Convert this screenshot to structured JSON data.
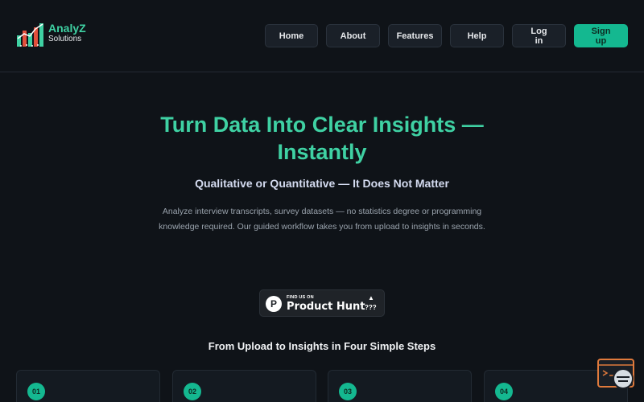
{
  "brand": {
    "name": "AnalyZ",
    "tagline": "Solutions",
    "accent": "#3fd1a3"
  },
  "nav": {
    "items": [
      {
        "label": "Home"
      },
      {
        "label": "About"
      },
      {
        "label": "Features"
      },
      {
        "label": "Help"
      },
      {
        "label": "Log in"
      }
    ],
    "cta": "Sign up"
  },
  "hero": {
    "title_line1": "Turn Data Into Clear Insights —",
    "title_line2": "Instantly",
    "subtitle": "Qualitative or Quantitative — It Does Not Matter",
    "description": "Analyze interview transcripts, survey datasets — no statistics degree or programming knowledge required. Our guided workflow takes you from upload to insights in seconds."
  },
  "product_hunt": {
    "small": "FIND US ON",
    "big": "Product Hunt",
    "count": "???",
    "logo_letter": "P",
    "arrow": "▲"
  },
  "steps": {
    "title": "From Upload to Insights in Four Simple Steps",
    "items": [
      {
        "number": "01"
      },
      {
        "number": "02"
      },
      {
        "number": "03"
      },
      {
        "number": "04"
      }
    ]
  },
  "colors": {
    "background": "#0f1318",
    "primary": "#14b890",
    "card": "#141a21"
  },
  "icons": {
    "logo": "bar-chart-logo-icon",
    "chat": "chat-support-icon"
  }
}
